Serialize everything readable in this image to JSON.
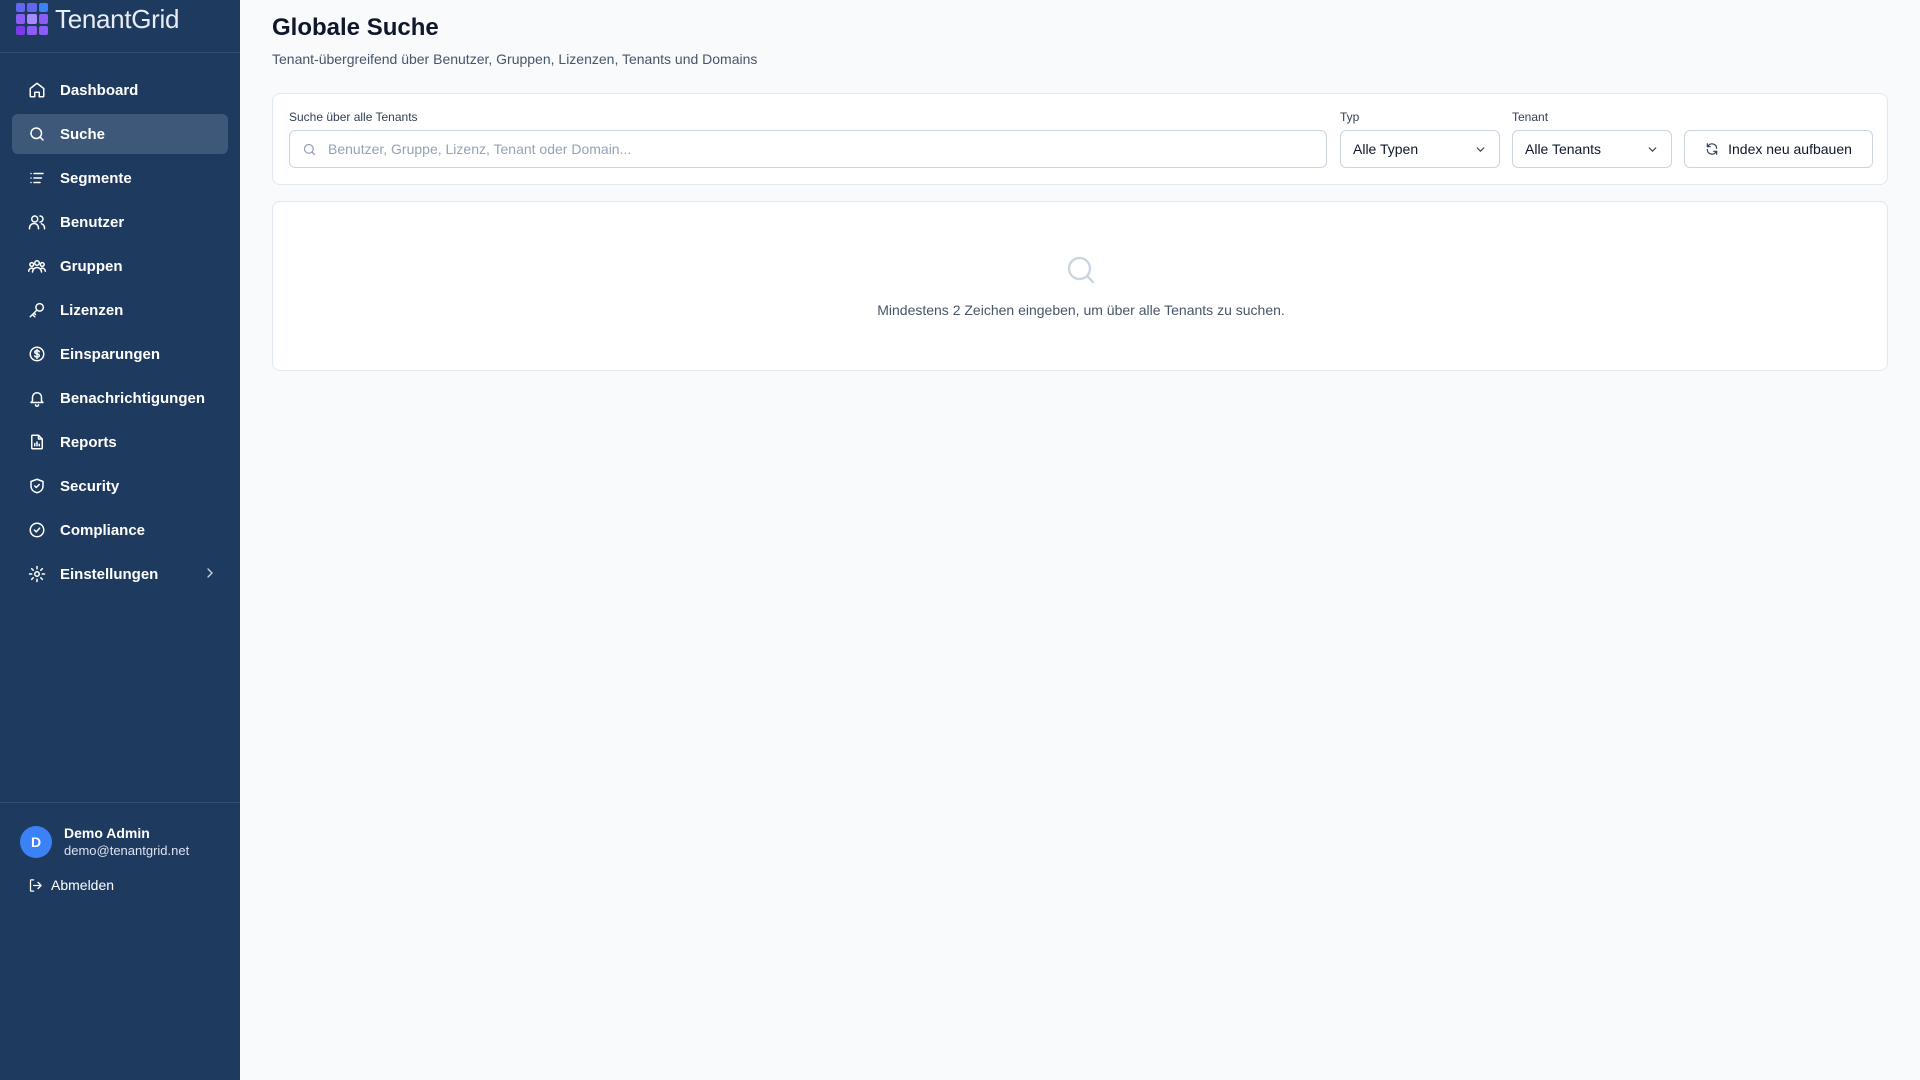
{
  "brand": {
    "name": "TenantGrid"
  },
  "nav": {
    "items": [
      {
        "label": "Dashboard",
        "icon": "home-icon"
      },
      {
        "label": "Suche",
        "icon": "search-icon",
        "active": true
      },
      {
        "label": "Segmente",
        "icon": "list-icon"
      },
      {
        "label": "Benutzer",
        "icon": "users-icon"
      },
      {
        "label": "Gruppen",
        "icon": "group-icon"
      },
      {
        "label": "Lizenzen",
        "icon": "key-icon"
      },
      {
        "label": "Einsparungen",
        "icon": "dollar-circle-icon"
      },
      {
        "label": "Benachrichtigungen",
        "icon": "bell-icon"
      },
      {
        "label": "Reports",
        "icon": "report-file-icon"
      },
      {
        "label": "Security",
        "icon": "shield-icon"
      },
      {
        "label": "Compliance",
        "icon": "check-circle-icon"
      },
      {
        "label": "Einstellungen",
        "icon": "gear-icon",
        "expandable": true
      }
    ]
  },
  "user": {
    "initial": "D",
    "name": "Demo Admin",
    "email": "demo@tenantgrid.net",
    "logout_label": "Abmelden"
  },
  "page": {
    "title": "Globale Suche",
    "subtitle": "Tenant-übergreifend über Benutzer, Gruppen, Lizenzen, Tenants und Domains"
  },
  "search": {
    "label": "Suche über alle Tenants",
    "placeholder": "Benutzer, Gruppe, Lizenz, Tenant oder Domain...",
    "value": ""
  },
  "filters": {
    "type_label": "Typ",
    "type_value": "Alle Typen",
    "tenant_label": "Tenant",
    "tenant_value": "Alle Tenants"
  },
  "actions": {
    "rebuild_label": "Index neu aufbauen"
  },
  "empty_state": {
    "message": "Mindestens 2 Zeichen eingeben, um über alle Tenants zu suchen."
  },
  "colors": {
    "sidebar_bg": "#1e3a5f",
    "sidebar_active": "#3d5878",
    "page_bg": "#f8fafc",
    "avatar": "#3b82f6"
  }
}
